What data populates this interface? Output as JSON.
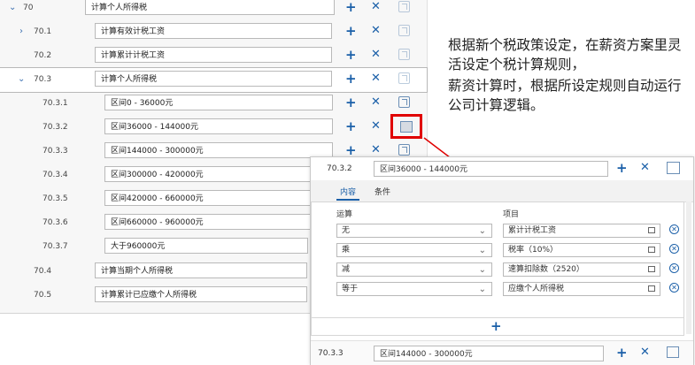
{
  "tree": {
    "rows": [
      {
        "code": "70",
        "value": "计算个人所得税",
        "chevron": "down"
      },
      {
        "code": "70.1",
        "value": "计算有效计税工资",
        "chevron": "right"
      },
      {
        "code": "70.2",
        "value": "计算累计计税工资",
        "chevron": ""
      },
      {
        "code": "70.3",
        "value": "计算个人所得税",
        "chevron": "down"
      },
      {
        "code": "70.3.1",
        "value": "区间0 - 36000元",
        "chevron": ""
      },
      {
        "code": "70.3.2",
        "value": "区间36000 - 144000元",
        "chevron": ""
      },
      {
        "code": "70.3.3",
        "value": "区间144000 - 300000元",
        "chevron": ""
      },
      {
        "code": "70.3.4",
        "value": "区间300000 - 420000元",
        "chevron": ""
      },
      {
        "code": "70.3.5",
        "value": "区间420000 - 660000元",
        "chevron": ""
      },
      {
        "code": "70.3.6",
        "value": "区间660000 - 960000元",
        "chevron": ""
      },
      {
        "code": "70.3.7",
        "value": "大于960000元",
        "chevron": ""
      },
      {
        "code": "70.4",
        "value": "计算当期个人所得税",
        "chevron": ""
      },
      {
        "code": "70.5",
        "value": "计算累计已应缴个人所得税",
        "chevron": ""
      }
    ],
    "plus": "+",
    "close": "✕"
  },
  "description": {
    "line1": "根据新个税政策设定，在薪资方案里灵活设定个税计算规则，",
    "line2": "薪资计算时，根据所设定规则自动运行公司计算逻辑。"
  },
  "panel": {
    "header": {
      "code": "70.3.2",
      "value": "区间36000 - 144000元"
    },
    "tabs": [
      "内容",
      "条件"
    ],
    "columns": {
      "op": "运算",
      "item": "项目"
    },
    "rows": [
      {
        "op": "无",
        "item": "累计计税工资"
      },
      {
        "op": "乘",
        "item": "税率（10%）"
      },
      {
        "op": "减",
        "item": "速算扣除数（2520）"
      },
      {
        "op": "等于",
        "item": "应缴个人所得税"
      }
    ],
    "footer": {
      "code": "70.3.3",
      "value": "区间144000 - 300000元"
    }
  },
  "colors": {
    "accent": "#1a5fa8",
    "highlight": "#e00000"
  }
}
